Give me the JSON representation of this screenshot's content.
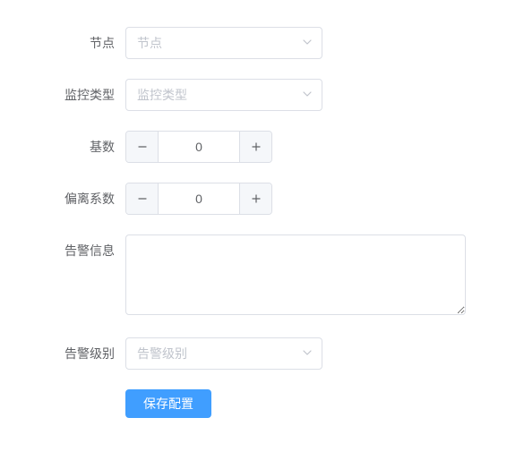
{
  "form": {
    "node": {
      "label": "节点",
      "placeholder": "节点"
    },
    "monitorType": {
      "label": "监控类型",
      "placeholder": "监控类型"
    },
    "base": {
      "label": "基数",
      "value": "0"
    },
    "deviation": {
      "label": "偏离系数",
      "value": "0"
    },
    "alarmInfo": {
      "label": "告警信息",
      "value": ""
    },
    "alarmLevel": {
      "label": "告警级别",
      "placeholder": "告警级别"
    },
    "submit": {
      "label": "保存配置"
    }
  }
}
